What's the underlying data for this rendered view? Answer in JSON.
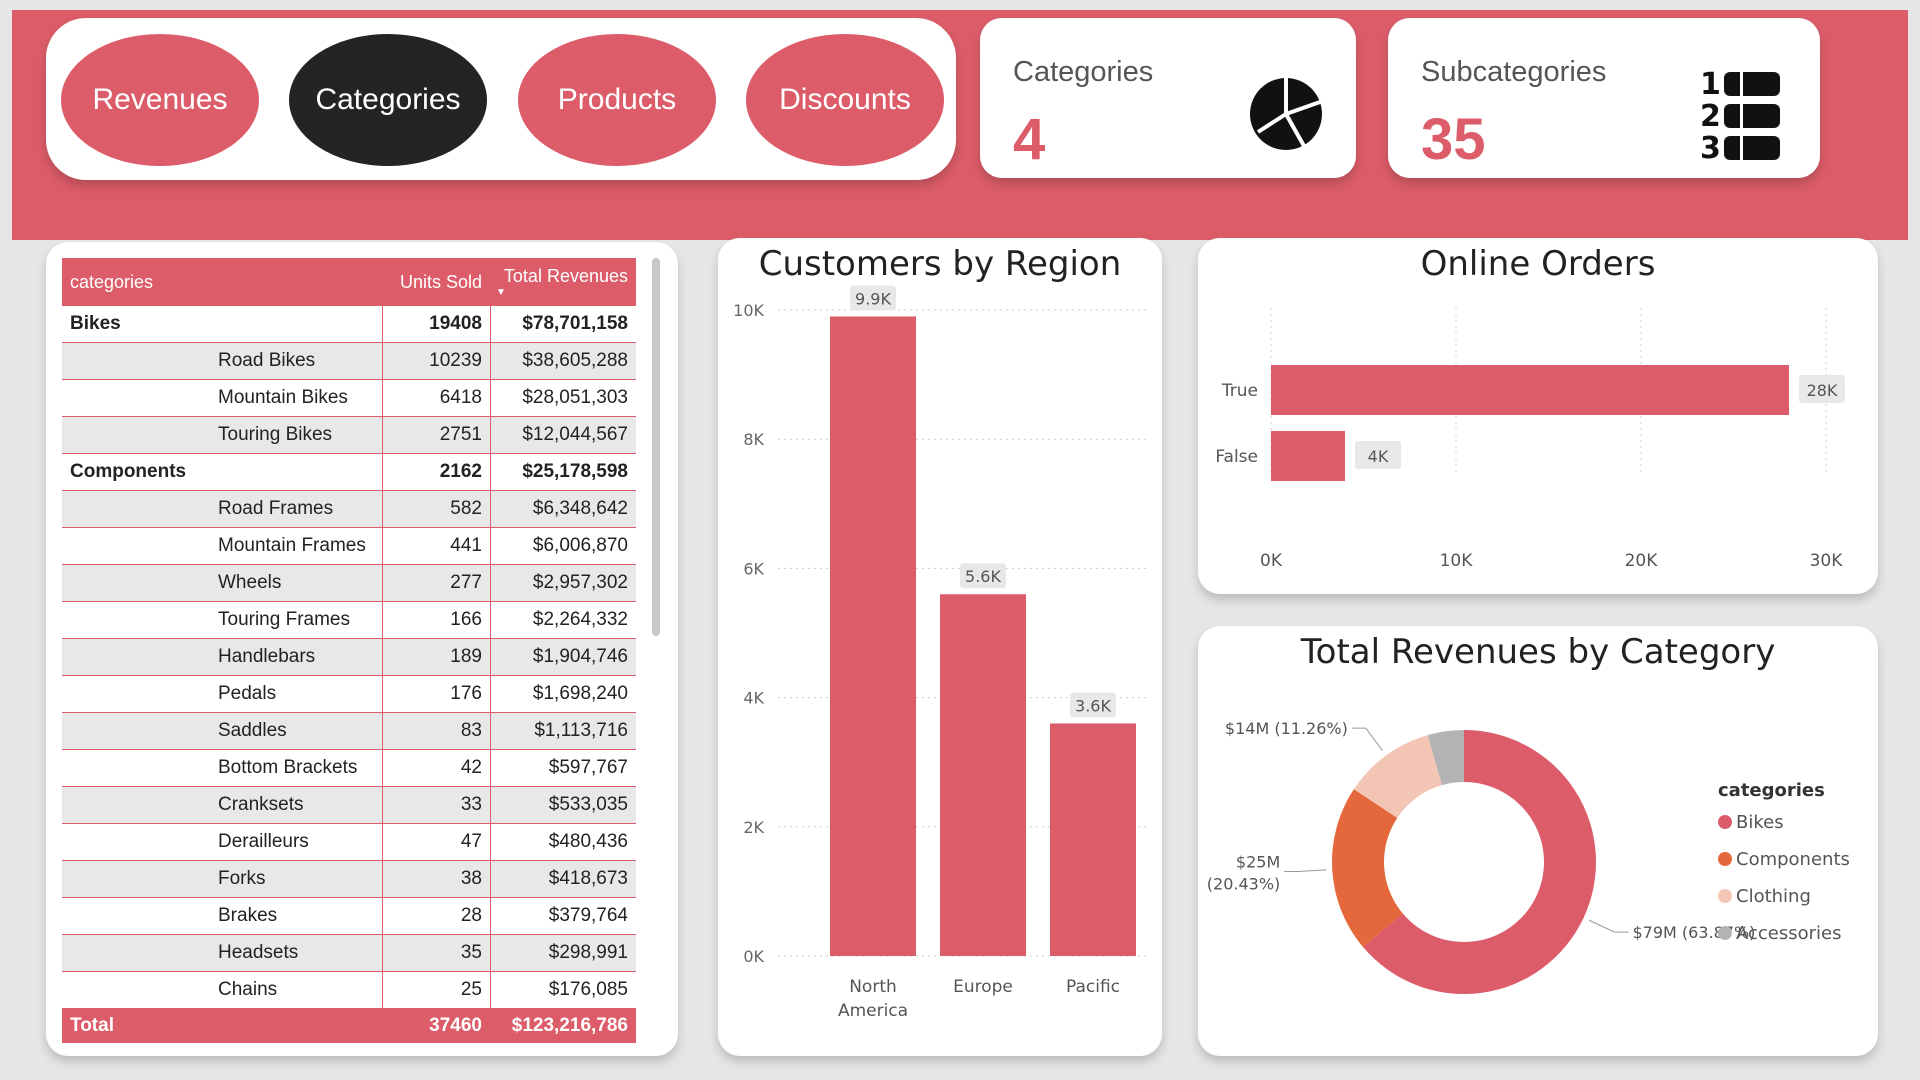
{
  "colors": {
    "accent": "#dc5d69",
    "active_nav": "#252423",
    "components": "#e4683c",
    "clothing": "#f3c5b5",
    "accessories": "#b3b3b3"
  },
  "nav": {
    "items": [
      {
        "label": "Revenues",
        "active": false
      },
      {
        "label": "Categories",
        "active": true
      },
      {
        "label": "Products",
        "active": false
      },
      {
        "label": "Discounts",
        "active": false
      }
    ]
  },
  "kpis": {
    "categories": {
      "label": "Categories",
      "value": "4",
      "icon": "pie-chart-icon"
    },
    "subcategories": {
      "label": "Subcategories",
      "value": "35",
      "icon": "numbered-list-icon"
    }
  },
  "table": {
    "headers": {
      "category": "categories",
      "units": "Units Sold",
      "revenues": "Total Revenues"
    },
    "rows": [
      {
        "name": "Bikes",
        "units": "19408",
        "rev": "$78,701,158",
        "level": 0
      },
      {
        "name": "Road Bikes",
        "units": "10239",
        "rev": "$38,605,288",
        "level": 1
      },
      {
        "name": "Mountain Bikes",
        "units": "6418",
        "rev": "$28,051,303",
        "level": 1
      },
      {
        "name": "Touring Bikes",
        "units": "2751",
        "rev": "$12,044,567",
        "level": 1
      },
      {
        "name": "Components",
        "units": "2162",
        "rev": "$25,178,598",
        "level": 0
      },
      {
        "name": "Road Frames",
        "units": "582",
        "rev": "$6,348,642",
        "level": 1
      },
      {
        "name": "Mountain Frames",
        "units": "441",
        "rev": "$6,006,870",
        "level": 1
      },
      {
        "name": "Wheels",
        "units": "277",
        "rev": "$2,957,302",
        "level": 1
      },
      {
        "name": "Touring Frames",
        "units": "166",
        "rev": "$2,264,332",
        "level": 1
      },
      {
        "name": "Handlebars",
        "units": "189",
        "rev": "$1,904,746",
        "level": 1
      },
      {
        "name": "Pedals",
        "units": "176",
        "rev": "$1,698,240",
        "level": 1
      },
      {
        "name": "Saddles",
        "units": "83",
        "rev": "$1,113,716",
        "level": 1
      },
      {
        "name": "Bottom Brackets",
        "units": "42",
        "rev": "$597,767",
        "level": 1
      },
      {
        "name": "Cranksets",
        "units": "33",
        "rev": "$533,035",
        "level": 1
      },
      {
        "name": "Derailleurs",
        "units": "47",
        "rev": "$480,436",
        "level": 1
      },
      {
        "name": "Forks",
        "units": "38",
        "rev": "$418,673",
        "level": 1
      },
      {
        "name": "Brakes",
        "units": "28",
        "rev": "$379,764",
        "level": 1
      },
      {
        "name": "Headsets",
        "units": "35",
        "rev": "$298,991",
        "level": 1
      },
      {
        "name": "Chains",
        "units": "25",
        "rev": "$176,085",
        "level": 1
      }
    ],
    "total": {
      "name": "Total",
      "units": "37460",
      "rev": "$123,216,786"
    }
  },
  "chart_data": [
    {
      "type": "bar",
      "title": "Customers by Region",
      "categories": [
        "North America",
        "Europe",
        "Pacific"
      ],
      "category_lines": [
        [
          "North",
          "America"
        ],
        [
          "Europe"
        ],
        [
          "Pacific"
        ]
      ],
      "values": [
        9900,
        5600,
        3600
      ],
      "data_labels": [
        "9.9K",
        "5.6K",
        "3.6K"
      ],
      "ylim": [
        0,
        10000
      ],
      "yticks": [
        0,
        2000,
        4000,
        6000,
        8000,
        10000
      ],
      "ytick_labels": [
        "0K",
        "2K",
        "4K",
        "6K",
        "8K",
        "10K"
      ],
      "grid": true
    },
    {
      "type": "bar",
      "orientation": "horizontal",
      "title": "Online Orders",
      "categories": [
        "True",
        "False"
      ],
      "values": [
        28000,
        4000
      ],
      "data_labels": [
        "28K",
        "4K"
      ],
      "xlim": [
        0,
        30000
      ],
      "xticks": [
        0,
        10000,
        20000,
        30000
      ],
      "xtick_labels": [
        "0K",
        "10K",
        "20K",
        "30K"
      ],
      "grid": true
    },
    {
      "type": "pie",
      "donut": true,
      "title": "Total Revenues by Category",
      "legend_title": "categories",
      "legend_position": "right",
      "slices": [
        {
          "name": "Bikes",
          "value": 63.87,
          "label": "$79M (63.87%)",
          "color": "#dc5d69"
        },
        {
          "name": "Components",
          "value": 20.43,
          "label": "$25M (20.43%)",
          "color": "#e4683c"
        },
        {
          "name": "Clothing",
          "value": 11.26,
          "label": "$14M (11.26%)",
          "color": "#f3c5b5"
        },
        {
          "name": "Accessories",
          "value": 4.44,
          "label": "",
          "color": "#b3b3b3"
        }
      ]
    }
  ]
}
